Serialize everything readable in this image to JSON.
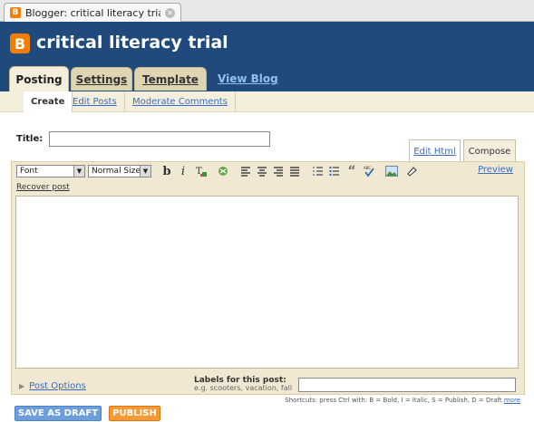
{
  "browser": {
    "tab_title": "Blogger: critical literacy trial - ...",
    "favicon": "B"
  },
  "header": {
    "logo": "B",
    "blog_title": "critical literacy trial"
  },
  "main_tabs": {
    "posting": "Posting",
    "settings": "Settings",
    "template": "Template",
    "view_blog": "View Blog"
  },
  "subnav": {
    "create": "Create",
    "edit_posts": "Edit Posts",
    "moderate_comments": "Moderate Comments"
  },
  "editor": {
    "title_label": "Title:",
    "title_value": "",
    "mode_edit_html": "Edit Html",
    "mode_compose": "Compose",
    "font_select": "Font",
    "size_select": "Normal Size",
    "preview": "Preview",
    "recover_post": "Recover post",
    "toolbar_icons": [
      "bold-icon",
      "italic-icon",
      "text-color-icon",
      "link-icon",
      "align-left-icon",
      "align-center-icon",
      "align-right-icon",
      "justify-icon",
      "numbered-list-icon",
      "bulleted-list-icon",
      "blockquote-icon",
      "spellcheck-icon",
      "image-icon",
      "remove-formatting-icon"
    ]
  },
  "footer": {
    "post_options": "Post Options",
    "labels_title": "Labels for this post:",
    "labels_hint": "e.g. scooters, vacation, fall",
    "labels_value": "",
    "shortcuts_text": "Shortcuts: press Ctrl with: B = Bold, I = Italic, S = Publish, D = Draft",
    "shortcuts_more": "more"
  },
  "buttons": {
    "save_draft": "SAVE AS DRAFT",
    "publish": "PUBLISH"
  },
  "colors": {
    "header_bg": "#1f4a7b",
    "brand_orange": "#f57d00",
    "link": "#3a6cc0",
    "draft_btn": "#6b9edb",
    "publish_btn": "#f79a36"
  }
}
